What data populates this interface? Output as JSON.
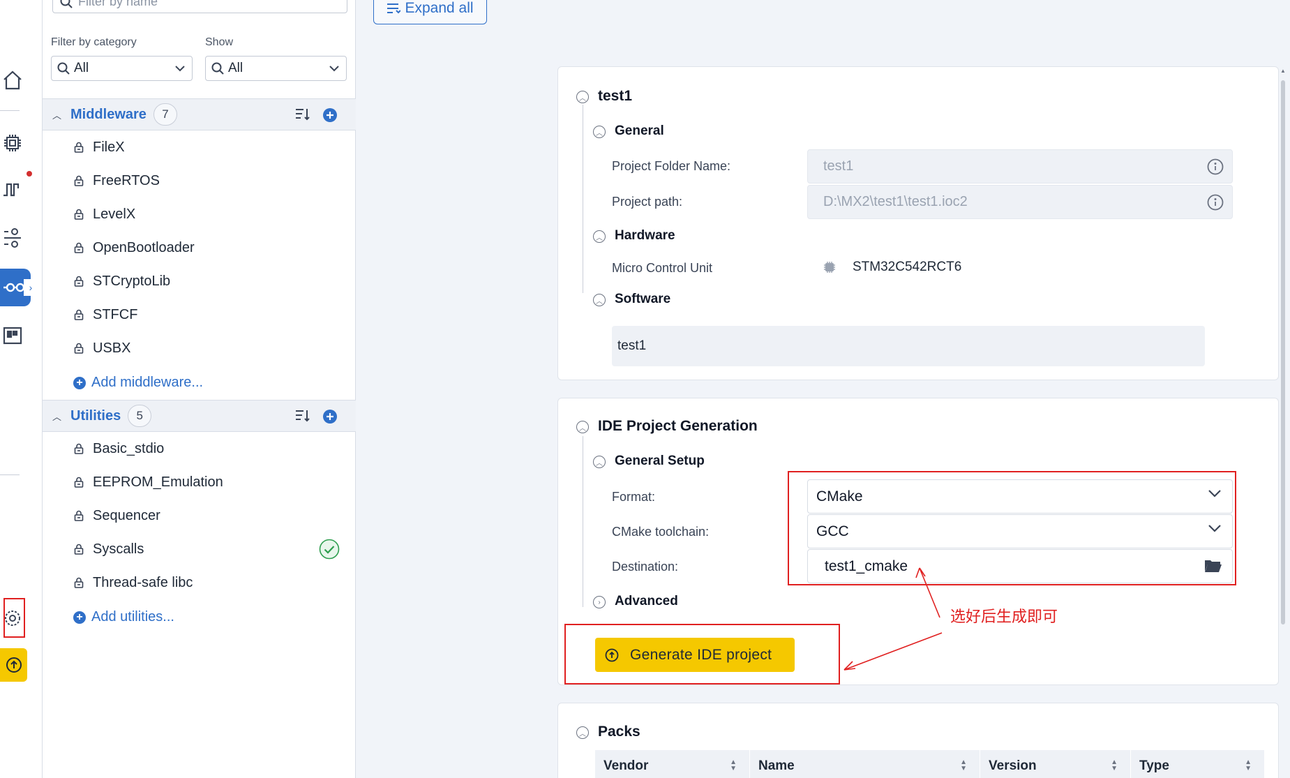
{
  "filter": {
    "name_placeholder": "Filter by name",
    "category_label": "Filter by category",
    "category_value": "All",
    "show_label": "Show",
    "show_value": "All"
  },
  "middleware": {
    "title": "Middleware",
    "count": "7",
    "items": [
      "FileX",
      "FreeRTOS",
      "LevelX",
      "OpenBootloader",
      "STCryptoLib",
      "STFCF",
      "USBX"
    ],
    "add_label": "Add middleware..."
  },
  "utilities": {
    "title": "Utilities",
    "count": "5",
    "items": [
      "Basic_stdio",
      "EEPROM_Emulation",
      "Sequencer",
      "Syscalls",
      "Thread-safe libc"
    ],
    "checked_item": "Syscalls",
    "add_label": "Add utilities..."
  },
  "toolbar": {
    "expand_label": "Expand all"
  },
  "project": {
    "title": "test1",
    "general": {
      "title": "General",
      "folder_label": "Project Folder Name:",
      "folder_value": "test1",
      "path_label": "Project path:",
      "path_value": "D:\\MX2\\test1\\test1.ioc2"
    },
    "hardware": {
      "title": "Hardware",
      "mcu_label": "Micro Control Unit",
      "mcu_value": "STM32C542RCT6"
    },
    "software": {
      "title": "Software",
      "value": "test1"
    }
  },
  "ide": {
    "title": "IDE Project Generation",
    "setup_title": "General Setup",
    "format_label": "Format:",
    "format_value": "CMake",
    "toolchain_label": "CMake toolchain:",
    "toolchain_value": "GCC",
    "destination_label": "Destination:",
    "destination_value": "test1_cmake",
    "advanced_title": "Advanced",
    "generate_label": "Generate IDE project"
  },
  "annotation": "选好后生成即可",
  "packs": {
    "title": "Packs",
    "columns": [
      "Vendor",
      "Name",
      "Version",
      "Type"
    ]
  },
  "colors": {
    "accent": "#2f6fc8",
    "generate": "#f5c800",
    "annotation_red": "#e02020",
    "success": "#2e9e4f"
  }
}
